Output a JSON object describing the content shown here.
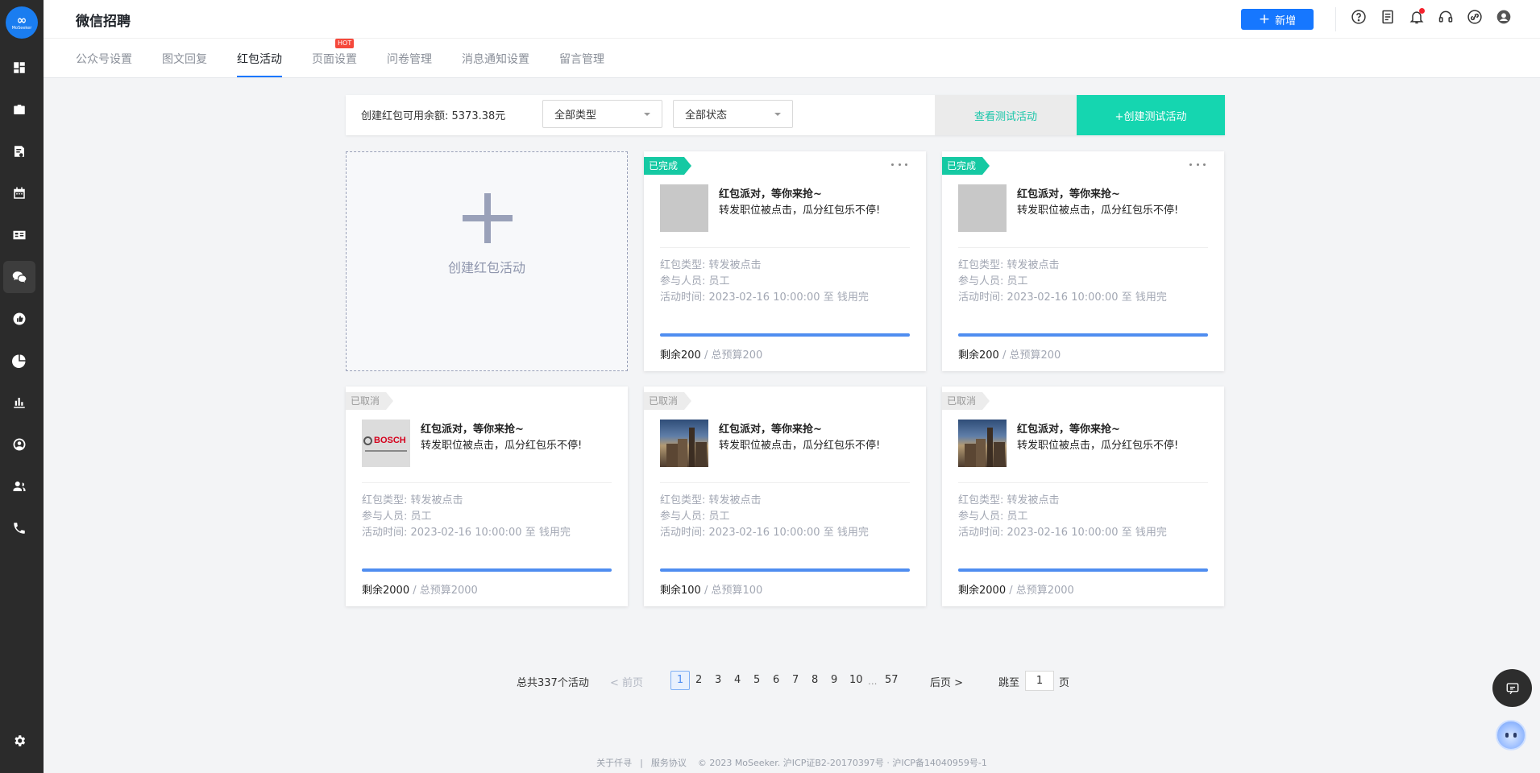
{
  "app": {
    "title": "微信招聘",
    "logo_text": "MoSeeker"
  },
  "header": {
    "new_button": "新增"
  },
  "tabs": [
    {
      "label": "公众号设置"
    },
    {
      "label": "图文回复"
    },
    {
      "label": "红包活动"
    },
    {
      "label": "页面设置",
      "badge": "HOT"
    },
    {
      "label": "问卷管理"
    },
    {
      "label": "消息通知设置"
    },
    {
      "label": "留言管理"
    }
  ],
  "active_tab": "红包活动",
  "filter": {
    "balance": "创建红包可用余额: 5373.38元",
    "type_select": "全部类型",
    "status_select": "全部状态",
    "view_test": "查看测试活动",
    "create_test": "+创建测试活动"
  },
  "add_card": {
    "label": "创建红包活动"
  },
  "cards": [
    {
      "status": "已完成",
      "title": "红包派对，等你来抢~",
      "subtitle": "转发职位被点击，瓜分红包乐不停!",
      "type": "红包类型: 转发被点击",
      "participants": "参与人员: 员工",
      "time": "活动时间: 2023-02-16 10:00:00 至 钱用完",
      "remain": "剩余200",
      "total": " / 总预算200",
      "progress": 1.0
    },
    {
      "status": "已完成",
      "title": "红包派对，等你来抢~",
      "subtitle": "转发职位被点击，瓜分红包乐不停!",
      "type": "红包类型: 转发被点击",
      "participants": "参与人员: 员工",
      "time": "活动时间: 2023-02-16 10:00:00 至 钱用完",
      "remain": "剩余200",
      "total": " / 总预算200",
      "progress": 1.0
    },
    {
      "status": "已取消",
      "title": "红包派对，等你来抢~",
      "subtitle": "转发职位被点击，瓜分红包乐不停!",
      "type": "红包类型: 转发被点击",
      "participants": "参与人员: 员工",
      "time": "活动时间: 2023-02-16 10:00:00 至 钱用完",
      "remain": "剩余2000",
      "total": " / 总预算2000",
      "progress": 1.0,
      "thumb_text": "BOSCH"
    },
    {
      "status": "已取消",
      "title": "红包派对，等你来抢~",
      "subtitle": "转发职位被点击，瓜分红包乐不停!",
      "type": "红包类型: 转发被点击",
      "participants": "参与人员: 员工",
      "time": "活动时间: 2023-02-16 10:00:00 至 钱用完",
      "remain": "剩余100",
      "total": " / 总预算100",
      "progress": 1.0
    },
    {
      "status": "已取消",
      "title": "红包派对，等你来抢~",
      "subtitle": "转发职位被点击，瓜分红包乐不停!",
      "type": "红包类型: 转发被点击",
      "participants": "参与人员: 员工",
      "time": "活动时间: 2023-02-16 10:00:00 至 钱用完",
      "remain": "剩余2000",
      "total": " / 总预算2000",
      "progress": 1.0
    }
  ],
  "pagination": {
    "total": "总共337个活动",
    "prev": "< 前页",
    "pages": [
      "1",
      "2",
      "3",
      "4",
      "5",
      "6",
      "7",
      "8",
      "9",
      "10"
    ],
    "ellipsis": "...",
    "last": "57",
    "next": "后页 >",
    "jump_label": "跳至",
    "jump_value": "1",
    "page_label": "页"
  },
  "footer": {
    "about": "关于仟寻",
    "sep": "|",
    "terms": "服务协议",
    "copyright": "© 2023 MoSeeker. 沪ICP证B2-20170397号 · 沪ICP备14040959号-1"
  },
  "colors": {
    "primary": "#1677ff",
    "teal": "#15d6b0",
    "sidebar": "#2b2b2b",
    "progress": "#4f8df0"
  },
  "icons": {
    "sidebar": [
      "dashboard-icon",
      "briefcase-icon",
      "resume-icon",
      "calendar-icon",
      "id-card-icon",
      "wechat-icon",
      "thumb-up-icon",
      "pie-chart-icon",
      "bar-chart-icon",
      "person-circle-icon",
      "team-icon",
      "phone-icon",
      "settings-icon"
    ],
    "header": [
      "help-icon",
      "document-icon",
      "bell-icon",
      "headset-icon",
      "link-icon",
      "user-avatar-icon"
    ]
  }
}
